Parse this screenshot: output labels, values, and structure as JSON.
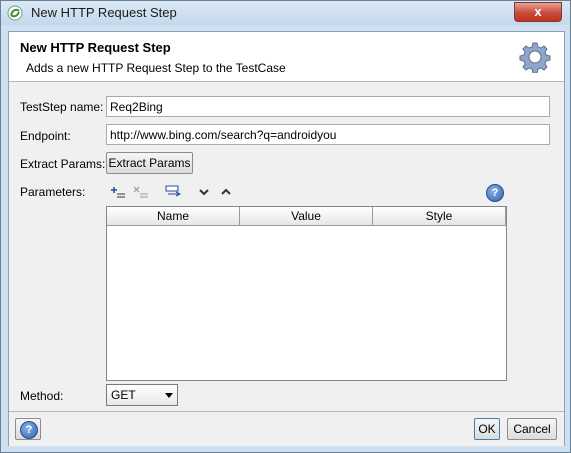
{
  "window": {
    "title": "New HTTP Request Step",
    "close_label": "x"
  },
  "header": {
    "title": "New HTTP Request Step",
    "description": "Adds a new HTTP Request Step to the TestCase"
  },
  "form": {
    "teststep_name_label": "TestStep name:",
    "teststep_name_value": "Req2Bing",
    "endpoint_label": "Endpoint:",
    "endpoint_value": "http://www.bing.com/search?q=androidyou",
    "extract_params_label": "Extract Params:",
    "extract_params_button": "Extract Params",
    "parameters_label": "Parameters:",
    "method_label": "Method:",
    "method_value": "GET"
  },
  "params_table": {
    "columns": [
      "Name",
      "Value",
      "Style"
    ],
    "rows": []
  },
  "toolbar": {
    "icons": [
      "add-param-icon",
      "remove-param-icon",
      "url-param-icon",
      "move-down-icon",
      "move-up-icon"
    ]
  },
  "footer": {
    "ok_label": "OK",
    "cancel_label": "Cancel"
  },
  "colors": {
    "title_bar": "#c5d8ec",
    "close_button": "#c74b3c",
    "help_blue": "#2f5fae"
  }
}
